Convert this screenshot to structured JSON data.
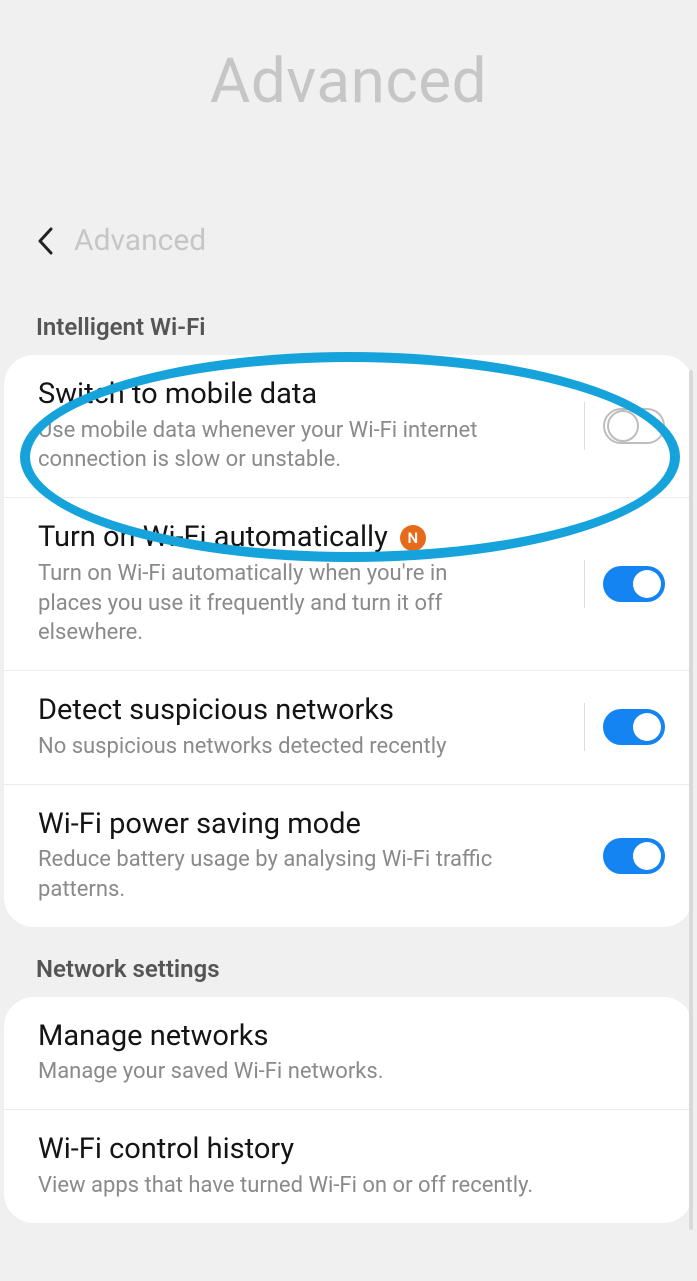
{
  "hero": {
    "title": "Advanced"
  },
  "toprow": {
    "title": "Advanced"
  },
  "sections": {
    "intelligent_wifi": {
      "label": "Intelligent Wi-Fi",
      "items": [
        {
          "title": "Switch to mobile data",
          "desc": "Use mobile data whenever your Wi-Fi internet connection is slow or unstable.",
          "toggled": false
        },
        {
          "title": "Turn on Wi-Fi automatically",
          "desc": "Turn on Wi-Fi automatically when you're in places you use it frequently and turn it off elsewhere.",
          "badge": "N",
          "toggled": true
        },
        {
          "title": "Detect suspicious networks",
          "desc": "No suspicious networks detected recently",
          "toggled": true
        },
        {
          "title": "Wi-Fi power saving mode",
          "desc": "Reduce battery usage by analysing Wi-Fi traffic patterns.",
          "toggled": true
        }
      ]
    },
    "network_settings": {
      "label": "Network settings",
      "items": [
        {
          "title": "Manage networks",
          "desc": "Manage your saved Wi-Fi networks."
        },
        {
          "title": "Wi-Fi control history",
          "desc": "View apps that have turned Wi-Fi on or off recently."
        }
      ]
    }
  }
}
